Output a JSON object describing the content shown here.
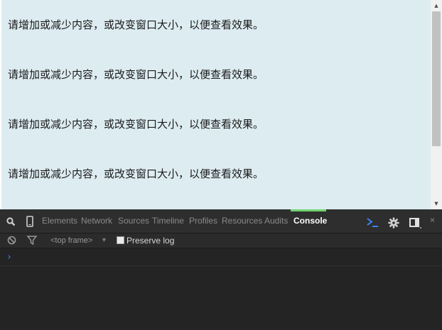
{
  "content": {
    "paragraphs": [
      "请增加或减少内容，或改变窗口大小，以便查看效果。",
      "请增加或减少内容，或改变窗口大小，以便查看效果。",
      "请增加或减少内容，或改变窗口大小，以便查看效果。",
      "请增加或减少内容，或改变窗口大小，以便查看效果。"
    ]
  },
  "devtools": {
    "tabs": [
      "Elements",
      "Network",
      "Sources",
      "Timeline",
      "Profiles",
      "Resources",
      "Audits",
      "Console"
    ],
    "active_tab": "Console",
    "frame_selector": "<top frame>",
    "preserve_log_label": "Preserve log",
    "prompt_symbol": "›",
    "close_symbol": "×"
  },
  "colors": {
    "page_background": "#ddecf1",
    "devtools_background": "#242424",
    "active_tab_indicator": "#6fd36f",
    "prompt": "#3b82f6"
  }
}
